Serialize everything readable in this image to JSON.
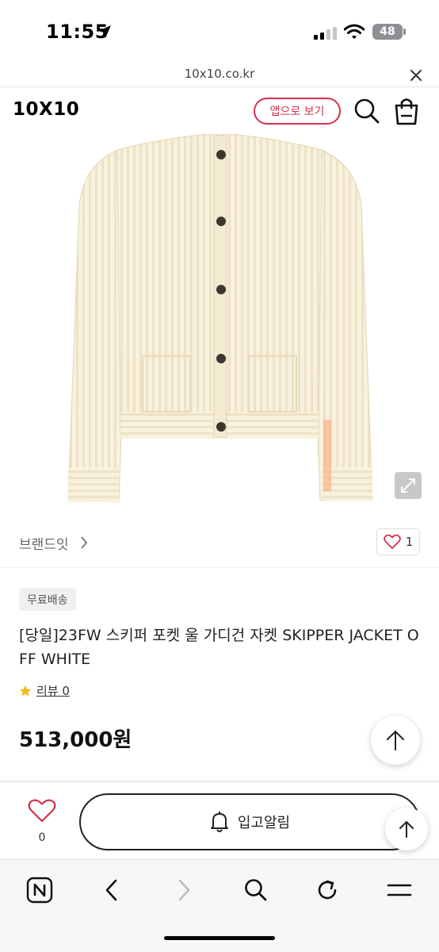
{
  "status": {
    "time": "11:55",
    "battery": "48"
  },
  "browser": {
    "url": "10x10.co.kr"
  },
  "header": {
    "logo": "10X10",
    "app_button": "앱으로 보기"
  },
  "brand": {
    "name": "브랜드잇",
    "like_count": "1"
  },
  "product": {
    "badge": "무료배송",
    "title": "[당일]23FW 스키퍼 포켓 울 가디건 자켓 SKIPPER JACKET OFF WHITE",
    "review_label": "리뷰 0",
    "price": "513,000원",
    "color": "#f6efdc"
  },
  "action_bar": {
    "wish_count": "0",
    "notify_label": "입고알림"
  },
  "colors": {
    "accent": "#d4314a"
  },
  "icons": [
    "location-arrow-icon",
    "wifi-icon",
    "close-icon",
    "search-icon",
    "shopping-bag-icon",
    "expand-icon",
    "heart-icon",
    "star-icon",
    "bell-icon",
    "arrow-up-icon",
    "naver-icon",
    "back-icon",
    "forward-icon",
    "refresh-icon",
    "menu-icon"
  ]
}
